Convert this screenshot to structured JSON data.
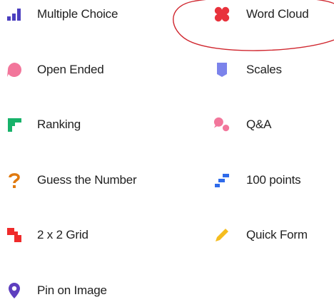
{
  "question_types": {
    "left": [
      {
        "key": "multiple-choice",
        "label": "Multiple Choice",
        "icon": "bar-chart-icon",
        "color": "#4b3fbf"
      },
      {
        "key": "open-ended",
        "label": "Open Ended",
        "icon": "speech-bubble-icon",
        "color": "#f2769b"
      },
      {
        "key": "ranking",
        "label": "Ranking",
        "icon": "ranking-icon",
        "color": "#17b26a"
      },
      {
        "key": "guess-the-number",
        "label": "Guess the Number",
        "icon": "question-mark-icon",
        "color": "#e07a10"
      },
      {
        "key": "2x2-grid",
        "label": "2 x 2 Grid",
        "icon": "grid-icon",
        "color": "#ef2b2b"
      },
      {
        "key": "pin-on-image",
        "label": "Pin on Image",
        "icon": "map-pin-icon",
        "color": "#5e3fbf"
      }
    ],
    "right": [
      {
        "key": "word-cloud",
        "label": "Word Cloud",
        "icon": "word-cloud-icon",
        "color": "#e8323c"
      },
      {
        "key": "scales",
        "label": "Scales",
        "icon": "scales-icon",
        "color": "#7b83eb"
      },
      {
        "key": "qa",
        "label": "Q&A",
        "icon": "qa-bubbles-icon",
        "color": "#f2769b"
      },
      {
        "key": "100-points",
        "label": "100 points",
        "icon": "points-icon",
        "color": "#2f6bea"
      },
      {
        "key": "quick-form",
        "label": "Quick Form",
        "icon": "pencil-icon",
        "color": "#f5bd1f"
      }
    ]
  },
  "annotation": {
    "shape": "ellipse",
    "target": "word-cloud",
    "color": "#d0272f"
  }
}
